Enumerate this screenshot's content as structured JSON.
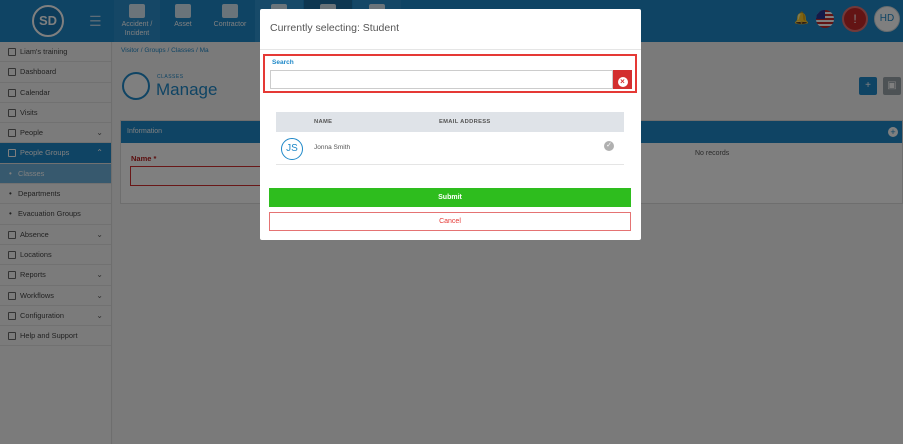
{
  "app": {
    "logo_text": "SD",
    "user_initials": "HD"
  },
  "nav_tiles": [
    {
      "label": "Accident / Incident"
    },
    {
      "label": "Asset"
    },
    {
      "label": "Contractor"
    }
  ],
  "sidebar": {
    "items": [
      {
        "label": "Liam's training"
      },
      {
        "label": "Dashboard"
      },
      {
        "label": "Calendar"
      },
      {
        "label": "Visits"
      },
      {
        "label": "People"
      },
      {
        "label": "People Groups"
      },
      {
        "label": "Classes"
      },
      {
        "label": "Departments"
      },
      {
        "label": "Evacuation Groups"
      },
      {
        "label": "Absence"
      },
      {
        "label": "Locations"
      },
      {
        "label": "Reports"
      },
      {
        "label": "Workflows"
      },
      {
        "label": "Configuration"
      },
      {
        "label": "Help and Support"
      }
    ]
  },
  "breadcrumb": {
    "text": "Visitor  /   Groups  /   Classes  /   Ma"
  },
  "page": {
    "kicker": "CLASSES",
    "title": "Manage"
  },
  "info_panel": {
    "title": "Information",
    "name_label": "Name",
    "required_mark": "*",
    "no_records": "No records"
  },
  "modal": {
    "title": "Currently selecting:  Student",
    "search": {
      "label": "Search",
      "value": "",
      "placeholder": ""
    },
    "columns": {
      "name": "NAME",
      "email": "EMAIL ADDRESS"
    },
    "results": [
      {
        "initials": "JS",
        "name": "Jonna Smith"
      }
    ],
    "submit_label": "Submit",
    "cancel_label": "Cancel"
  },
  "colors": {
    "brand": "#1e88c8",
    "submit": "#2ebd1e",
    "danger": "#e53935"
  }
}
